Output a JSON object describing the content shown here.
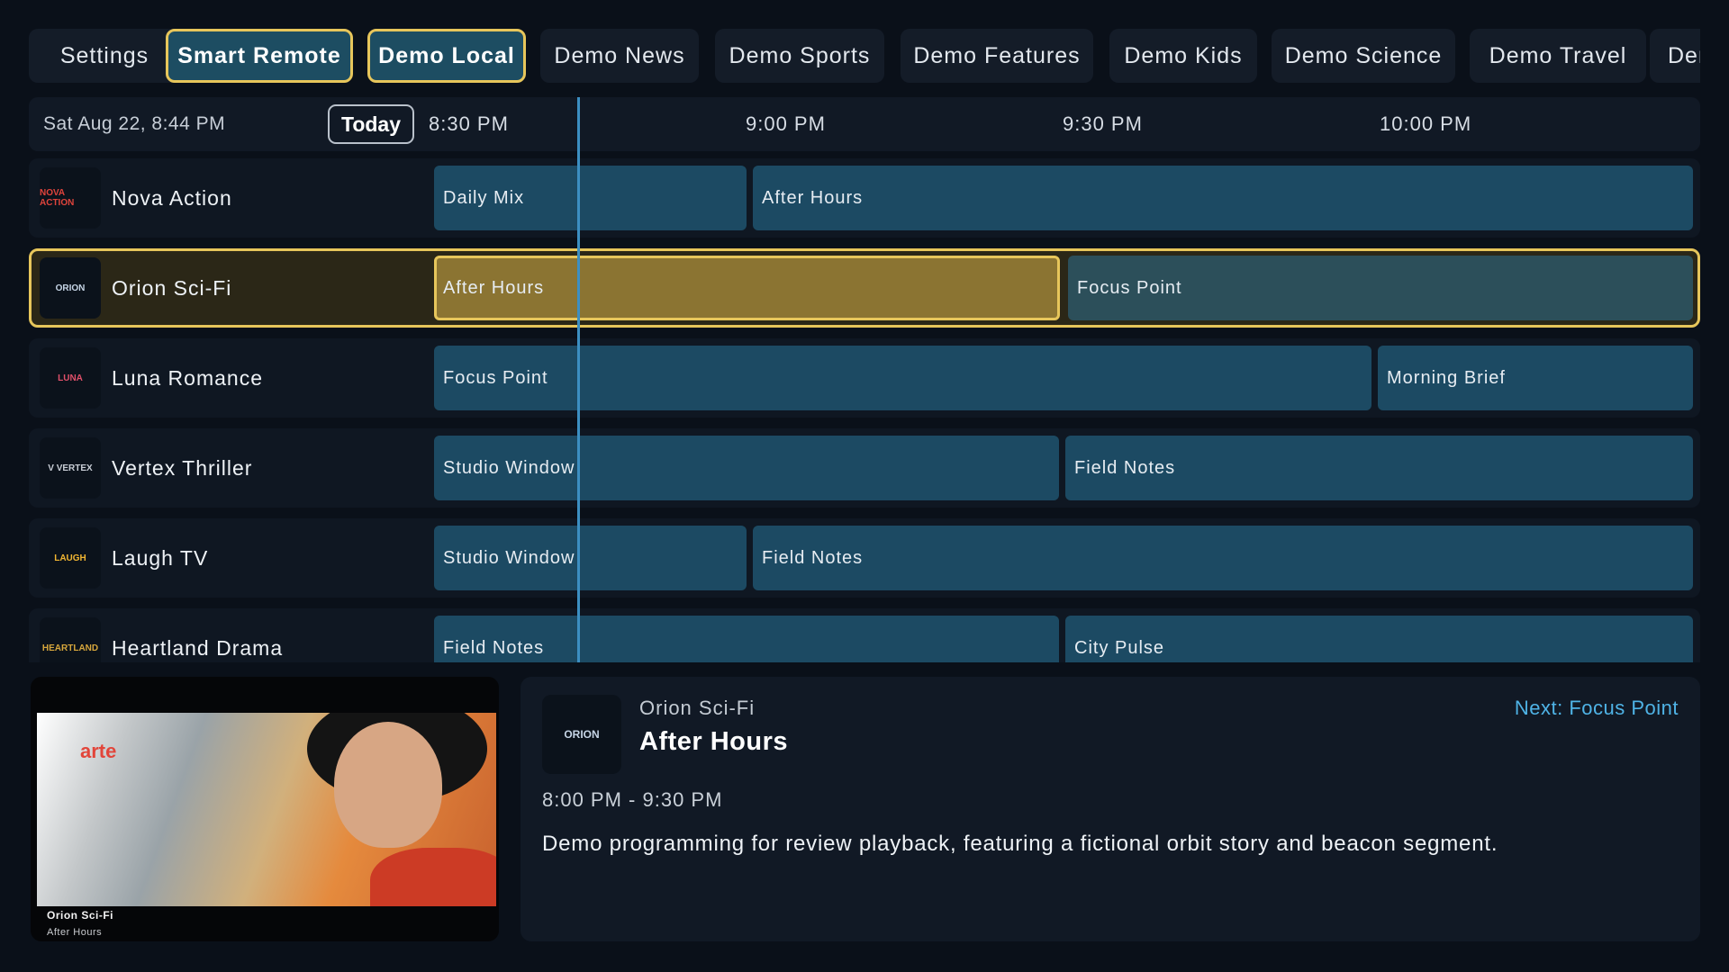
{
  "tabs": [
    {
      "label": "Settings",
      "active": false
    },
    {
      "label": "Smart Remote",
      "active": true
    },
    {
      "label": "Demo Local",
      "active": true
    },
    {
      "label": "Demo News",
      "active": false
    },
    {
      "label": "Demo Sports",
      "active": false
    },
    {
      "label": "Demo Features",
      "active": false
    },
    {
      "label": "Demo Kids",
      "active": false
    },
    {
      "label": "Demo Science",
      "active": false
    },
    {
      "label": "Demo Travel",
      "active": false
    },
    {
      "label": "Der",
      "active": false
    }
  ],
  "guide": {
    "date": "Sat Aug 22, 8:44 PM",
    "today_label": "Today",
    "times": [
      "8:30 PM",
      "9:00 PM",
      "9:30 PM",
      "10:00 PM"
    ],
    "channels": [
      {
        "name": "Nova Action",
        "logo_text": "NOVA ACTION",
        "logo_icon": "nova-action-logo-icon",
        "programs": [
          "Daily Mix",
          "After Hours"
        ]
      },
      {
        "name": "Orion Sci-Fi",
        "logo_text": "ORION",
        "logo_icon": "orion-scifi-logo-icon",
        "selected": true,
        "programs": [
          "After Hours",
          "Focus Point"
        ]
      },
      {
        "name": "Luna Romance",
        "logo_text": "LUNA",
        "logo_icon": "luna-romance-logo-icon",
        "programs": [
          "Focus Point",
          "Morning Brief"
        ]
      },
      {
        "name": "Vertex Thriller",
        "logo_text": "V VERTEX",
        "logo_icon": "vertex-thriller-logo-icon",
        "programs": [
          "Studio Window",
          "Field Notes"
        ]
      },
      {
        "name": "Laugh TV",
        "logo_text": "LAUGH",
        "logo_icon": "laugh-tv-logo-icon",
        "programs": [
          "Studio Window",
          "Field Notes"
        ]
      },
      {
        "name": "Heartland Drama",
        "logo_text": "HEARTLAND",
        "logo_icon": "heartland-drama-logo-icon",
        "programs": [
          "Field Notes",
          "City Pulse"
        ]
      }
    ]
  },
  "preview": {
    "channel": "Orion Sci-Fi",
    "program": "After Hours",
    "overlay_logo": "arte"
  },
  "details": {
    "logo_text": "ORION",
    "channel": "Orion Sci-Fi",
    "title": "After Hours",
    "next": "Next: Focus Point",
    "time": "8:00 PM - 9:30 PM",
    "description": "Demo programming for review playback, featuring a fictional orbit story and beacon segment."
  },
  "colors": {
    "accent_gold": "#e7c65b",
    "program_blue": "#1c4a63",
    "now_line": "#3c8fc2",
    "next_link": "#4fb3e6"
  }
}
